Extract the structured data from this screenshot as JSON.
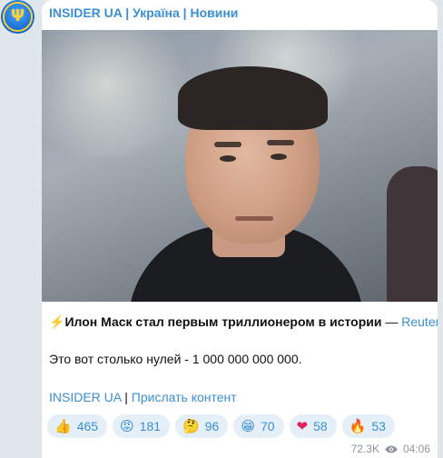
{
  "channel": {
    "name": "INSIDER UA | Україна | Новини",
    "avatar_glyph": "Ψ"
  },
  "post": {
    "headline_icon": "⚡",
    "headline": "Илон Маск стал первым триллионером в истории",
    "headline_separator": " — ",
    "source_link": "Reuters",
    "body": "Это вот столько нулей - 1 000 000 000 000.",
    "footer_link_channel": "INSIDER UA",
    "footer_separator": " | ",
    "footer_link_submit": "Прислать контент"
  },
  "reactions": [
    {
      "emoji": "👍",
      "count": "465"
    },
    {
      "emoji": "😡",
      "count": "181"
    },
    {
      "emoji": "🤔",
      "count": "96"
    },
    {
      "emoji": "😁",
      "count": "70"
    },
    {
      "emoji": "❤",
      "count": "58"
    },
    {
      "emoji": "🔥",
      "count": "53"
    }
  ],
  "meta": {
    "views": "72.3K",
    "time": "04:06"
  },
  "colors": {
    "link": "#3a8fd6",
    "background": "#dfe6ec",
    "reaction_bg": "#e4eff8"
  }
}
